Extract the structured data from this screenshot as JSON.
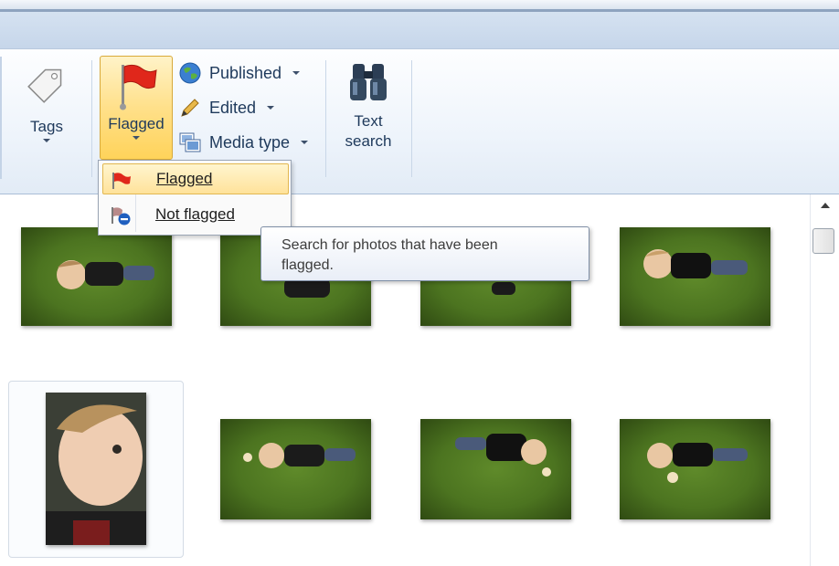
{
  "ribbon": {
    "tags": {
      "label": "Tags",
      "icon": "tag-icon"
    },
    "flagged": {
      "label": "Flagged",
      "icon": "red-flag-icon"
    },
    "published": {
      "label": "Published",
      "icon": "globe-icon"
    },
    "edited": {
      "label": "Edited",
      "icon": "pencil-icon"
    },
    "media_type": {
      "label": "Media type",
      "icon": "media-type-icon"
    },
    "text_search": {
      "label_line1": "Text",
      "label_line2": "search",
      "icon": "binoculars-icon"
    }
  },
  "flag_menu": {
    "items": [
      {
        "label": "Flagged",
        "icon": "flag-icon",
        "highlighted": true
      },
      {
        "label": "Not flagged",
        "icon": "not-flagged-icon",
        "highlighted": false
      }
    ]
  },
  "tooltip": {
    "line1": "Search for photos that have been",
    "line2": "flagged."
  },
  "colors": {
    "ribbon_text": "#1e395b",
    "highlight": "#ffe08a",
    "flag_red": "#e0271b",
    "grass": "#4c7420"
  }
}
